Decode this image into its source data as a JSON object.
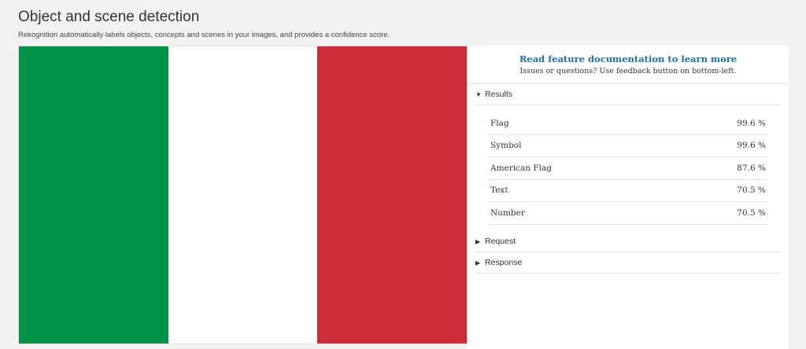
{
  "header": {
    "title": "Object and scene detection",
    "subtitle": "Rekognition automatically labels objects, concepts and scenes in your images, and provides a confidence score."
  },
  "image": {
    "stripe_colors": [
      "#009246",
      "#ffffff",
      "#ce2b37"
    ]
  },
  "panel": {
    "doc_link": "Read feature documentation to learn more",
    "doc_note": "Issues or questions? Use feedback button on bottom-left.",
    "sections": {
      "results": "Results",
      "request": "Request",
      "response": "Response"
    },
    "results": [
      {
        "label": "Flag",
        "confidence": "99.6 %"
      },
      {
        "label": "Symbol",
        "confidence": "99.6 %"
      },
      {
        "label": "American Flag",
        "confidence": "87.6 %"
      },
      {
        "label": "Text",
        "confidence": "70.5 %"
      },
      {
        "label": "Number",
        "confidence": "70.5 %"
      }
    ]
  },
  "colors": {
    "link": "#1a6fb5",
    "background": "#f2f2f2"
  }
}
